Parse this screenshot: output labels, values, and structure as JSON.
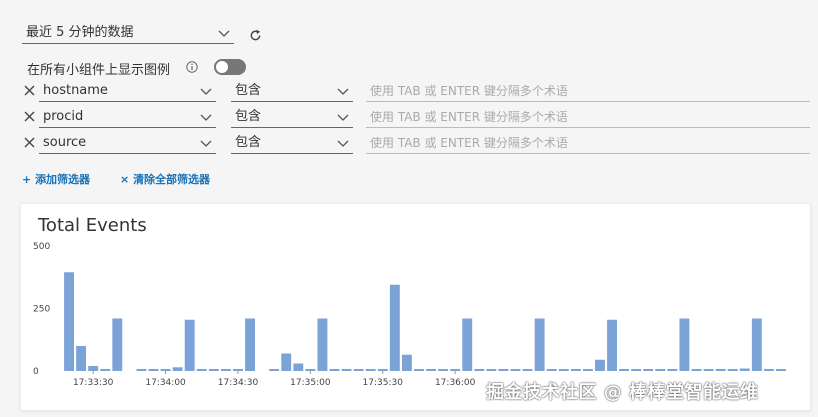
{
  "time_range": {
    "selected": "最近 5 分钟的数据"
  },
  "legend_toggle": {
    "label": "在所有小组件上显示图例",
    "enabled": false
  },
  "filters": [
    {
      "field": "hostname",
      "operator": "包含",
      "placeholder": "使用 TAB 或 ENTER 键分隔多个术语"
    },
    {
      "field": "procid",
      "operator": "包含",
      "placeholder": "使用 TAB 或 ENTER 键分隔多个术语"
    },
    {
      "field": "source",
      "operator": "包含",
      "placeholder": "使用 TAB 或 ENTER 键分隔多个术语"
    }
  ],
  "actions": {
    "add_filter": "添加筛选器",
    "clear_filters": "清除全部筛选器"
  },
  "widget": {
    "title": "Total Events"
  },
  "chart_data": {
    "type": "bar",
    "ylim": [
      0,
      500
    ],
    "yticks": [
      "500",
      "250",
      "0"
    ],
    "bar_color": "#7ba3d8",
    "xticks": [
      {
        "index": 2,
        "label": "17:33:30"
      },
      {
        "index": 8,
        "label": "17:34:00"
      },
      {
        "index": 14,
        "label": "17:34:30"
      },
      {
        "index": 20,
        "label": "17:35:00"
      },
      {
        "index": 26,
        "label": "17:35:30"
      },
      {
        "index": 32,
        "label": "17:36:00"
      }
    ],
    "values": [
      395,
      100,
      20,
      8,
      210,
      0,
      8,
      8,
      8,
      15,
      205,
      8,
      8,
      8,
      8,
      210,
      0,
      8,
      70,
      30,
      8,
      210,
      8,
      8,
      8,
      8,
      8,
      345,
      65,
      8,
      8,
      8,
      8,
      210,
      8,
      8,
      8,
      8,
      8,
      210,
      8,
      8,
      8,
      8,
      45,
      205,
      8,
      8,
      8,
      8,
      8,
      210,
      8,
      8,
      8,
      8,
      10,
      210,
      8,
      8
    ]
  },
  "watermark": "掘金技术社区 @ 棒棒堂智能运维"
}
